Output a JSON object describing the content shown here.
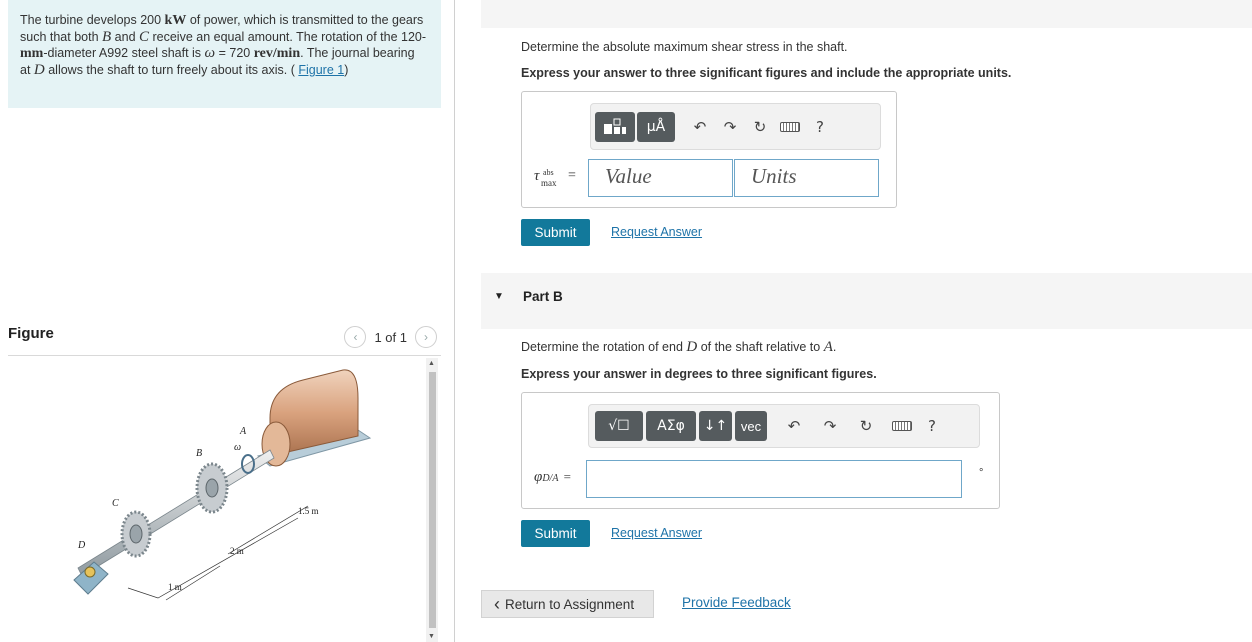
{
  "problem": {
    "t1": "The turbine develops 200 ",
    "power_unit": "kW",
    "t2": " of power, which is transmitted to the gears such that both ",
    "b": "B",
    "t3": " and ",
    "c": "C",
    "t4": " receive an equal amount. The rotation of the 120-",
    "mm": "mm",
    "t5": "-diameter A992 steel shaft is ",
    "omega": "ω",
    "t6": " = 720 ",
    "speed_unit": "rev/min",
    "t7": ". The journal bearing at ",
    "d": "D",
    "t8": " allows the shaft to turn freely about its axis. (",
    "figure_link": "Figure 1",
    "t9": ")"
  },
  "figure": {
    "title": "Figure",
    "counter": "1 of 1",
    "prev_icon": "‹",
    "next_icon": "›",
    "labels": {
      "a": "A",
      "b": "B",
      "c": "C",
      "d": "D",
      "omega": "ω",
      "d1": "1 m",
      "d2": "2 m",
      "d3": "1.5 m"
    }
  },
  "part_a": {
    "question": "Determine the absolute maximum shear stress in the shaft.",
    "instruction": "Express your answer to three significant figures and include the appropriate units.",
    "toolbar": {
      "templates_icon": "templates-icon",
      "units_label": "μÅ",
      "undo": "↶",
      "redo": "↷",
      "reset": "↻",
      "help": "?"
    },
    "var_tau": "τ",
    "var_sup": "abs",
    "var_sub": "max",
    "equals": "=",
    "value_placeholder": "Value",
    "units_placeholder": "Units",
    "submit": "Submit",
    "request": "Request Answer"
  },
  "part_b": {
    "caret": "▼",
    "title": "Part B",
    "q1": "Determine the rotation of end ",
    "q_d": "D",
    "q2": " of the shaft relative to ",
    "q_a": "A",
    "q3": ".",
    "instruction": "Express your answer in degrees to three significant figures.",
    "toolbar": {
      "root_label": "√☐",
      "greek_label": "ΑΣφ",
      "arrows_label": "↓↑",
      "vec_label": "vec",
      "undo": "↶",
      "redo": "↷",
      "reset": "↻",
      "help": "?"
    },
    "var_phi": "φ",
    "var_sub": "D/A",
    "equals": "=",
    "degree": "°",
    "submit": "Submit",
    "request": "Request Answer"
  },
  "footer": {
    "return": "Return to Assignment",
    "return_icon": "‹",
    "feedback": "Provide Feedback"
  }
}
